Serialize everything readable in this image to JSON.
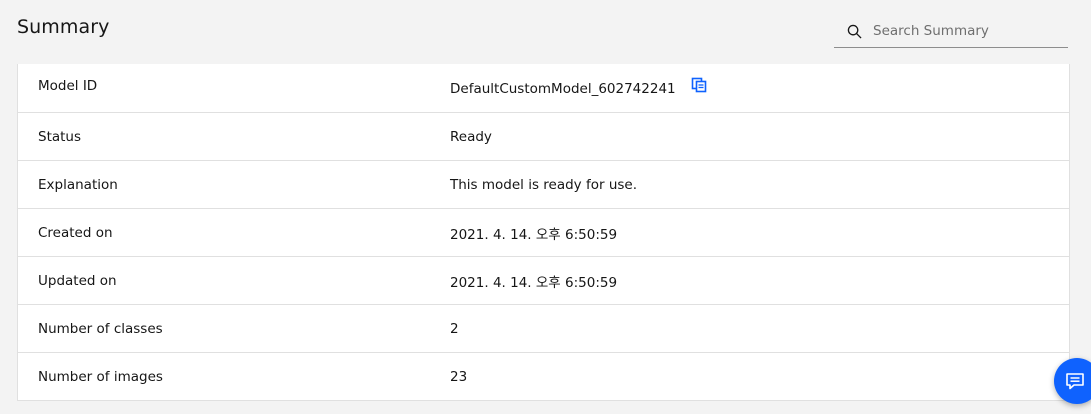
{
  "header": {
    "title": "Summary",
    "search_placeholder": "Search Summary",
    "search_value": ""
  },
  "summary": {
    "rows": [
      {
        "label": "Model ID",
        "value": "DefaultCustomModel_602742241"
      },
      {
        "label": "Status",
        "value": "Ready"
      },
      {
        "label": "Explanation",
        "value": "This model is ready for use."
      },
      {
        "label": "Created on",
        "value": "2021. 4. 14. 오후 6:50:59"
      },
      {
        "label": "Updated on",
        "value": "2021. 4. 14. 오후 6:50:59"
      },
      {
        "label": "Number of classes",
        "value": "2"
      },
      {
        "label": "Number of images",
        "value": "23"
      }
    ]
  },
  "icons": {
    "search": "search-icon",
    "copy": "copy-icon",
    "chat": "chat-icon"
  },
  "colors": {
    "accent": "#0f62fe",
    "background": "#f3f3f3",
    "table_background": "#ffffff",
    "border": "#e0e0e0"
  }
}
